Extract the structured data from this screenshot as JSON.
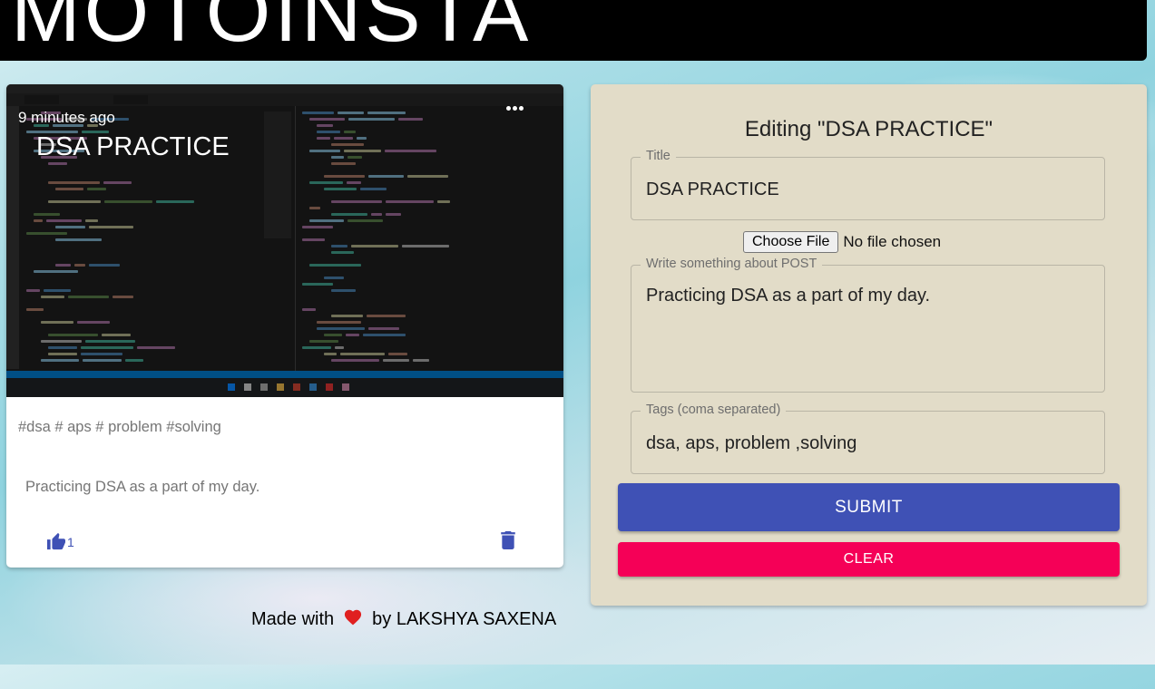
{
  "app": {
    "title": "MOTOINSTA"
  },
  "post": {
    "time_ago": "9 minutes ago",
    "title": "DSA PRACTICE",
    "tags": "#dsa # aps # problem #solving",
    "message": "Practicing DSA as a part of my day.",
    "like_count": "1",
    "icons": {
      "more": "more-horiz-icon",
      "like": "thumb-up-icon",
      "delete": "delete-icon"
    },
    "accent_color": "#3f51b5"
  },
  "form": {
    "heading": "Editing \"DSA PRACTICE\"",
    "title_label": "Title",
    "title_value": "DSA PRACTICE",
    "file_button": "Choose File",
    "file_status": "No file chosen",
    "message_label": "Write something about POST",
    "message_value": "Practicing DSA as a part of my day.",
    "tags_label": "Tags (coma separated)",
    "tags_value": "dsa, aps, problem ,solving",
    "submit_label": "SUBMIT",
    "clear_label": "CLEAR",
    "submit_color": "#3f51b5",
    "clear_color": "#f50057"
  },
  "footer": {
    "prefix": "Made with",
    "suffix": "by LAKSHYA SAXENA",
    "icon": "heart-icon"
  }
}
